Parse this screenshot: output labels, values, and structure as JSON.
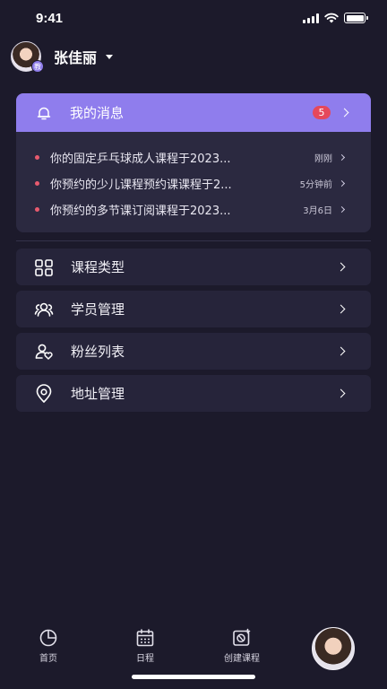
{
  "status": {
    "time": "9:41"
  },
  "user": {
    "name": "张佳丽",
    "badge": "教"
  },
  "messages": {
    "title": "我的消息",
    "unread": "5",
    "items": [
      {
        "text": "你的固定乒乓球成人课程于2023...",
        "time": "刚刚"
      },
      {
        "text": "你预约的少儿课程预约课课程于2...",
        "time": "5分钟前"
      },
      {
        "text": "你预约的多节课订阅课程于2023...",
        "time": "3月6日"
      }
    ]
  },
  "menu": [
    {
      "label": "课程类型",
      "icon": "grid-icon"
    },
    {
      "label": "学员管理",
      "icon": "users-icon"
    },
    {
      "label": "粉丝列表",
      "icon": "fans-icon"
    },
    {
      "label": "地址管理",
      "icon": "location-pin-icon"
    }
  ],
  "tabbar": {
    "home": "首页",
    "schedule": "日程",
    "create": "创建课程"
  },
  "colors": {
    "background": "#1c1a2b",
    "accent": "#8f7ded",
    "badge": "#e5485b"
  }
}
